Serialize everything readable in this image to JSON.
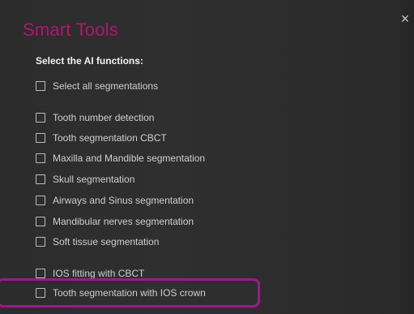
{
  "dialog": {
    "title": "Smart Tools",
    "close_glyph": "×",
    "subtitle": "Select the AI functions:"
  },
  "options": [
    {
      "label": "Select all segmentations",
      "checked": false
    },
    {
      "label": "Tooth number detection",
      "checked": false
    },
    {
      "label": "Tooth segmentation CBCT",
      "checked": false
    },
    {
      "label": "Maxilla and Mandible segmentation",
      "checked": false
    },
    {
      "label": "Skull segmentation",
      "checked": false
    },
    {
      "label": "Airways and Sinus segmentation",
      "checked": false
    },
    {
      "label": "Mandibular nerves segmentation",
      "checked": false
    },
    {
      "label": "Soft tissue segmentation",
      "checked": false
    },
    {
      "label": "IOS fitting with CBCT",
      "checked": false
    },
    {
      "label": "Tooth segmentation with IOS crown",
      "checked": false
    }
  ],
  "colors": {
    "title": "#b0176f",
    "highlight": "#a2158f",
    "background": "#2e2e2e"
  }
}
